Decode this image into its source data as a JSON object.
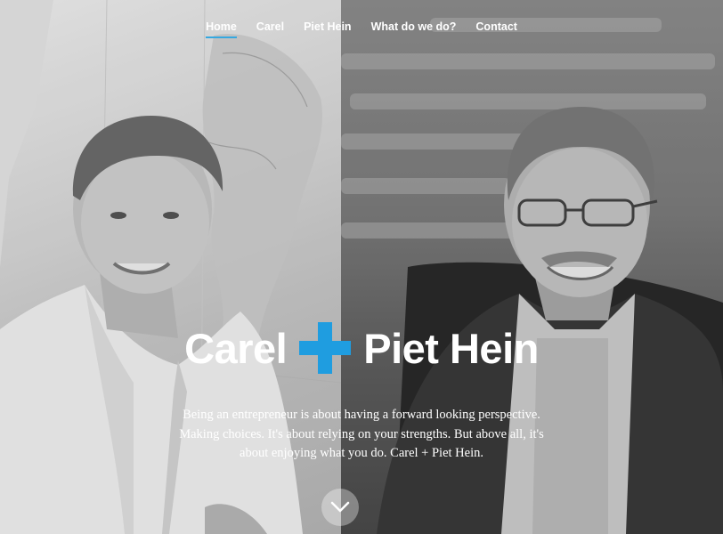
{
  "nav": {
    "items": [
      {
        "label": "Home",
        "active": true
      },
      {
        "label": "Carel",
        "active": false
      },
      {
        "label": "Piet Hein",
        "active": false
      },
      {
        "label": "What do we do?",
        "active": false
      },
      {
        "label": "Contact",
        "active": false
      }
    ]
  },
  "hero": {
    "name_left": "Carel",
    "name_right": "Piet Hein",
    "tagline_lines": [
      "Being an entrepreneur is about having a forward looking perspective.",
      "Making choices. It's about relying on your strengths. But above all, it's",
      "about enjoying what you do. Carel + Piet Hein."
    ]
  },
  "icons": {
    "plus": "plus-icon",
    "scroll": "chevron-down-icon"
  },
  "colors": {
    "accent": "#1f9de0",
    "nav_underline": "#35a8e0"
  }
}
